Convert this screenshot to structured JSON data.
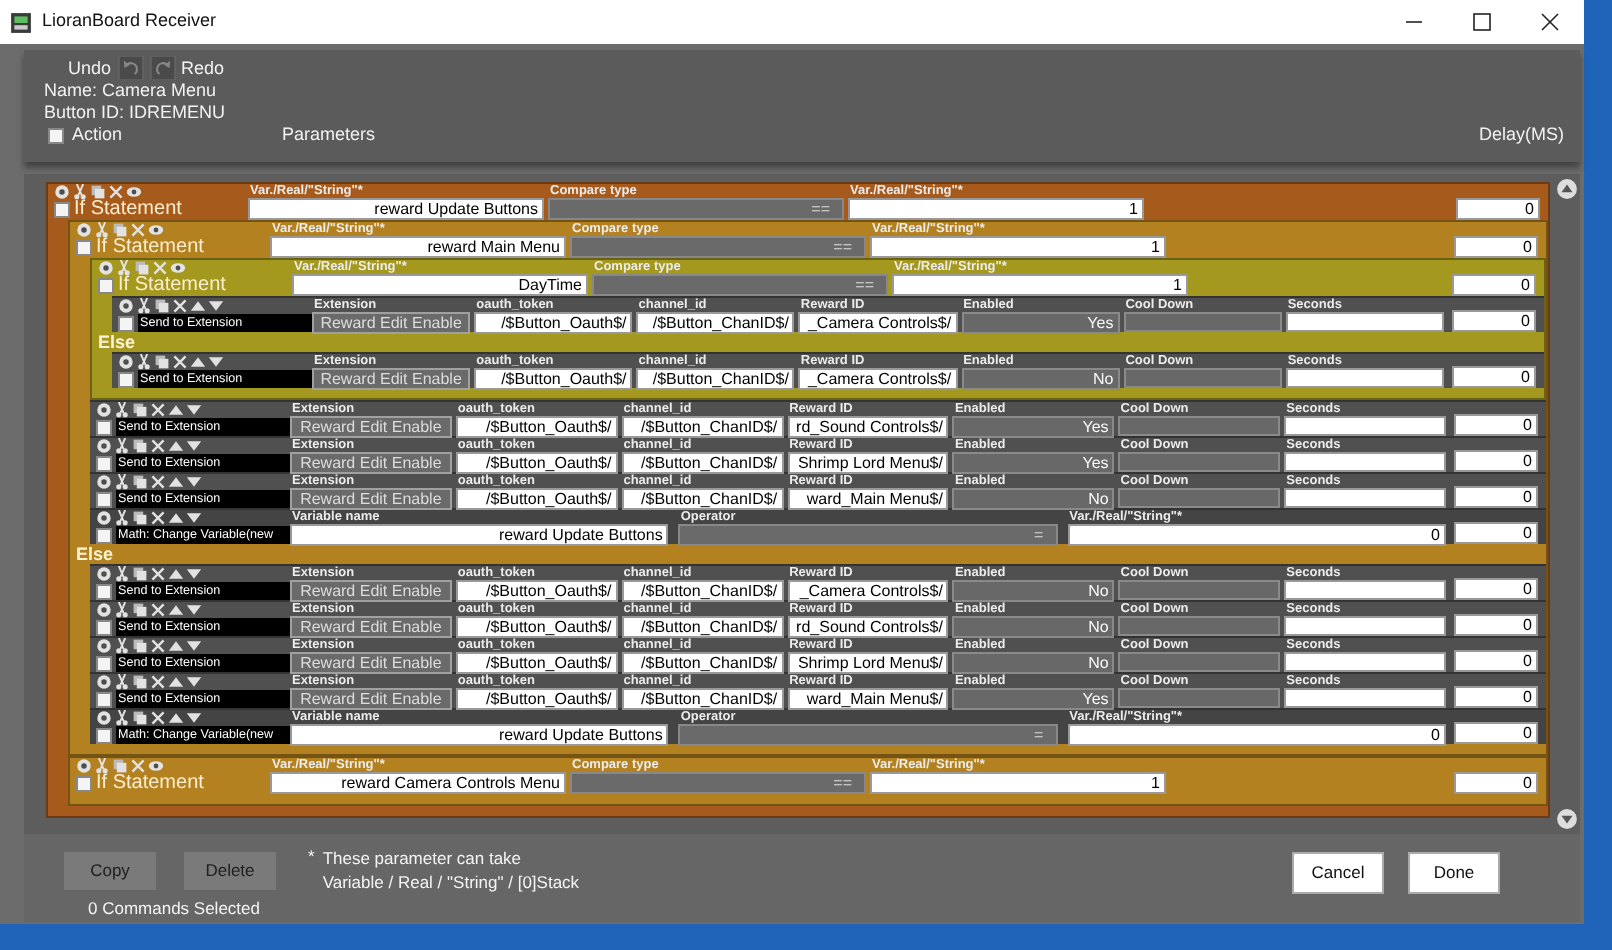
{
  "window": {
    "title": "LioranBoard Receiver"
  },
  "toolbar": {
    "undo": "Undo",
    "redo": "Redo"
  },
  "name": "Name: Camera Menu",
  "button_id": "Button ID: IDREMENU",
  "columns": {
    "checked": false,
    "action": "Action",
    "parameters": "Parameters",
    "delay": "Delay(MS)"
  },
  "commands": [
    {
      "kind": "if",
      "action": "If Statement",
      "checked": false,
      "fields": [
        {
          "label": "Var./Real/\"String\"*",
          "value": "reward Update Buttons",
          "kind": "input"
        },
        {
          "label": "Compare type",
          "value": "==",
          "kind": "select"
        },
        {
          "label": "Var./Real/\"String\"*",
          "value": "1",
          "kind": "input"
        }
      ],
      "delay": "0",
      "children": [
        {
          "kind": "if",
          "action": "If Statement",
          "checked": false,
          "fields": [
            {
              "label": "Var./Real/\"String\"*",
              "value": "reward Main Menu",
              "kind": "input"
            },
            {
              "label": "Compare type",
              "value": "==",
              "kind": "select"
            },
            {
              "label": "Var./Real/\"String\"*",
              "value": "1",
              "kind": "input"
            }
          ],
          "delay": "0",
          "children": [
            {
              "kind": "if",
              "action": "If Statement",
              "checked": false,
              "fields": [
                {
                  "label": "Var./Real/\"String\"*",
                  "value": "DayTime",
                  "kind": "input"
                },
                {
                  "label": "Compare type",
                  "value": "==",
                  "kind": "select"
                },
                {
                  "label": "Var./Real/\"String\"*",
                  "value": "1",
                  "kind": "input"
                }
              ],
              "delay": "0",
              "children": [
                {
                  "kind": "send",
                  "action": "Send to Extension",
                  "checked": false,
                  "fields": [
                    {
                      "label": "Extension",
                      "value": "Reward Edit Enable",
                      "kind": "button"
                    },
                    {
                      "label": "oauth_token",
                      "value": "/$Button_Oauth$/",
                      "kind": "input"
                    },
                    {
                      "label": "channel_id",
                      "value": "/$Button_ChanID$/",
                      "kind": "input"
                    },
                    {
                      "label": "Reward ID",
                      "value": "_Camera Controls$/",
                      "kind": "input"
                    },
                    {
                      "label": "Enabled",
                      "value": "Yes",
                      "kind": "readonly"
                    },
                    {
                      "label": "Cool Down",
                      "kind": "readonly"
                    },
                    {
                      "label": "Seconds",
                      "kind": "input"
                    }
                  ],
                  "delay": "0"
                }
              ],
              "else_label": "Else",
              "else_children": [
                {
                  "kind": "send",
                  "action": "Send to Extension",
                  "checked": false,
                  "fields": [
                    {
                      "label": "Extension",
                      "value": "Reward Edit Enable",
                      "kind": "button"
                    },
                    {
                      "label": "oauth_token",
                      "value": "/$Button_Oauth$/",
                      "kind": "input"
                    },
                    {
                      "label": "channel_id",
                      "value": "/$Button_ChanID$/",
                      "kind": "input"
                    },
                    {
                      "label": "Reward ID",
                      "value": "_Camera Controls$/",
                      "kind": "input"
                    },
                    {
                      "label": "Enabled",
                      "value": "No",
                      "kind": "readonly"
                    },
                    {
                      "label": "Cool Down",
                      "kind": "readonly"
                    },
                    {
                      "label": "Seconds",
                      "kind": "input"
                    }
                  ],
                  "delay": "0"
                }
              ]
            },
            {
              "kind": "send",
              "action": "Send to Extension",
              "checked": false,
              "fields": [
                {
                  "label": "Extension",
                  "value": "Reward Edit Enable",
                  "kind": "button"
                },
                {
                  "label": "oauth_token",
                  "value": "/$Button_Oauth$/",
                  "kind": "input"
                },
                {
                  "label": "channel_id",
                  "value": "/$Button_ChanID$/",
                  "kind": "input"
                },
                {
                  "label": "Reward ID",
                  "value": "rd_Sound Controls$/",
                  "kind": "input"
                },
                {
                  "label": "Enabled",
                  "value": "Yes",
                  "kind": "readonly"
                },
                {
                  "label": "Cool Down",
                  "kind": "readonly"
                },
                {
                  "label": "Seconds",
                  "kind": "input"
                }
              ],
              "delay": "0"
            },
            {
              "kind": "send",
              "action": "Send to Extension",
              "checked": false,
              "fields": [
                {
                  "label": "Extension",
                  "value": "Reward Edit Enable",
                  "kind": "button"
                },
                {
                  "label": "oauth_token",
                  "value": "/$Button_Oauth$/",
                  "kind": "input"
                },
                {
                  "label": "channel_id",
                  "value": "/$Button_ChanID$/",
                  "kind": "input"
                },
                {
                  "label": "Reward ID",
                  "value": "Shrimp Lord Menu$/",
                  "kind": "input"
                },
                {
                  "label": "Enabled",
                  "value": "Yes",
                  "kind": "readonly"
                },
                {
                  "label": "Cool Down",
                  "kind": "readonly"
                },
                {
                  "label": "Seconds",
                  "kind": "input"
                }
              ],
              "delay": "0"
            },
            {
              "kind": "send",
              "action": "Send to Extension",
              "checked": false,
              "fields": [
                {
                  "label": "Extension",
                  "value": "Reward Edit Enable",
                  "kind": "button"
                },
                {
                  "label": "oauth_token",
                  "value": "/$Button_Oauth$/",
                  "kind": "input"
                },
                {
                  "label": "channel_id",
                  "value": "/$Button_ChanID$/",
                  "kind": "input"
                },
                {
                  "label": "Reward ID",
                  "value": "ward_Main Menu$/",
                  "kind": "input"
                },
                {
                  "label": "Enabled",
                  "value": "No",
                  "kind": "readonly"
                },
                {
                  "label": "Cool Down",
                  "kind": "readonly"
                },
                {
                  "label": "Seconds",
                  "kind": "input"
                }
              ],
              "delay": "0"
            },
            {
              "kind": "math",
              "action": "Math: Change Variable(new",
              "checked": false,
              "fields": [
                {
                  "label": "Variable name",
                  "value": "reward Update Buttons",
                  "kind": "input"
                },
                {
                  "label": "Operator",
                  "value": "=",
                  "kind": "select"
                },
                {
                  "label": "Var./Real/\"String\"*",
                  "value": "0",
                  "kind": "input"
                }
              ],
              "delay": "0"
            }
          ],
          "else_label": "Else",
          "else_children": [
            {
              "kind": "send",
              "action": "Send to Extension",
              "checked": false,
              "fields": [
                {
                  "label": "Extension",
                  "value": "Reward Edit Enable",
                  "kind": "button"
                },
                {
                  "label": "oauth_token",
                  "value": "/$Button_Oauth$/",
                  "kind": "input"
                },
                {
                  "label": "channel_id",
                  "value": "/$Button_ChanID$/",
                  "kind": "input"
                },
                {
                  "label": "Reward ID",
                  "value": "_Camera Controls$/",
                  "kind": "input"
                },
                {
                  "label": "Enabled",
                  "value": "No",
                  "kind": "readonly"
                },
                {
                  "label": "Cool Down",
                  "kind": "readonly"
                },
                {
                  "label": "Seconds",
                  "kind": "input"
                }
              ],
              "delay": "0"
            },
            {
              "kind": "send",
              "action": "Send to Extension",
              "checked": false,
              "fields": [
                {
                  "label": "Extension",
                  "value": "Reward Edit Enable",
                  "kind": "button"
                },
                {
                  "label": "oauth_token",
                  "value": "/$Button_Oauth$/",
                  "kind": "input"
                },
                {
                  "label": "channel_id",
                  "value": "/$Button_ChanID$/",
                  "kind": "input"
                },
                {
                  "label": "Reward ID",
                  "value": "rd_Sound Controls$/",
                  "kind": "input"
                },
                {
                  "label": "Enabled",
                  "value": "No",
                  "kind": "readonly"
                },
                {
                  "label": "Cool Down",
                  "kind": "readonly"
                },
                {
                  "label": "Seconds",
                  "kind": "input"
                }
              ],
              "delay": "0"
            },
            {
              "kind": "send",
              "action": "Send to Extension",
              "checked": false,
              "fields": [
                {
                  "label": "Extension",
                  "value": "Reward Edit Enable",
                  "kind": "button"
                },
                {
                  "label": "oauth_token",
                  "value": "/$Button_Oauth$/",
                  "kind": "input"
                },
                {
                  "label": "channel_id",
                  "value": "/$Button_ChanID$/",
                  "kind": "input"
                },
                {
                  "label": "Reward ID",
                  "value": "Shrimp Lord Menu$/",
                  "kind": "input"
                },
                {
                  "label": "Enabled",
                  "value": "No",
                  "kind": "readonly"
                },
                {
                  "label": "Cool Down",
                  "kind": "readonly"
                },
                {
                  "label": "Seconds",
                  "kind": "input"
                }
              ],
              "delay": "0"
            },
            {
              "kind": "send",
              "action": "Send to Extension",
              "checked": false,
              "fields": [
                {
                  "label": "Extension",
                  "value": "Reward Edit Enable",
                  "kind": "button"
                },
                {
                  "label": "oauth_token",
                  "value": "/$Button_Oauth$/",
                  "kind": "input"
                },
                {
                  "label": "channel_id",
                  "value": "/$Button_ChanID$/",
                  "kind": "input"
                },
                {
                  "label": "Reward ID",
                  "value": "ward_Main Menu$/",
                  "kind": "input"
                },
                {
                  "label": "Enabled",
                  "value": "Yes",
                  "kind": "readonly"
                },
                {
                  "label": "Cool Down",
                  "kind": "readonly"
                },
                {
                  "label": "Seconds",
                  "kind": "input"
                }
              ],
              "delay": "0"
            },
            {
              "kind": "math",
              "action": "Math: Change Variable(new",
              "checked": false,
              "fields": [
                {
                  "label": "Variable name",
                  "value": "reward Update Buttons",
                  "kind": "input"
                },
                {
                  "label": "Operator",
                  "value": "=",
                  "kind": "select"
                },
                {
                  "label": "Var./Real/\"String\"*",
                  "value": "0",
                  "kind": "input"
                }
              ],
              "delay": "0"
            }
          ]
        },
        {
          "kind": "if",
          "action": "If Statement",
          "checked": false,
          "fields": [
            {
              "label": "Var./Real/\"String\"*",
              "value": "reward Camera Controls Menu",
              "kind": "input"
            },
            {
              "label": "Compare type",
              "value": "==",
              "kind": "select"
            },
            {
              "label": "Var./Real/\"String\"*",
              "value": "1",
              "kind": "input"
            }
          ],
          "delay": "0"
        }
      ]
    }
  ],
  "footer": {
    "buttons_left": [
      "Copy",
      "Delete"
    ],
    "note_mark": "*",
    "note_lines": [
      "These parameter can take",
      "Variable / Real / \"String\" / [0]Stack"
    ],
    "selection": "0 Commands Selected",
    "buttons_right": [
      "Cancel",
      "Done"
    ]
  }
}
